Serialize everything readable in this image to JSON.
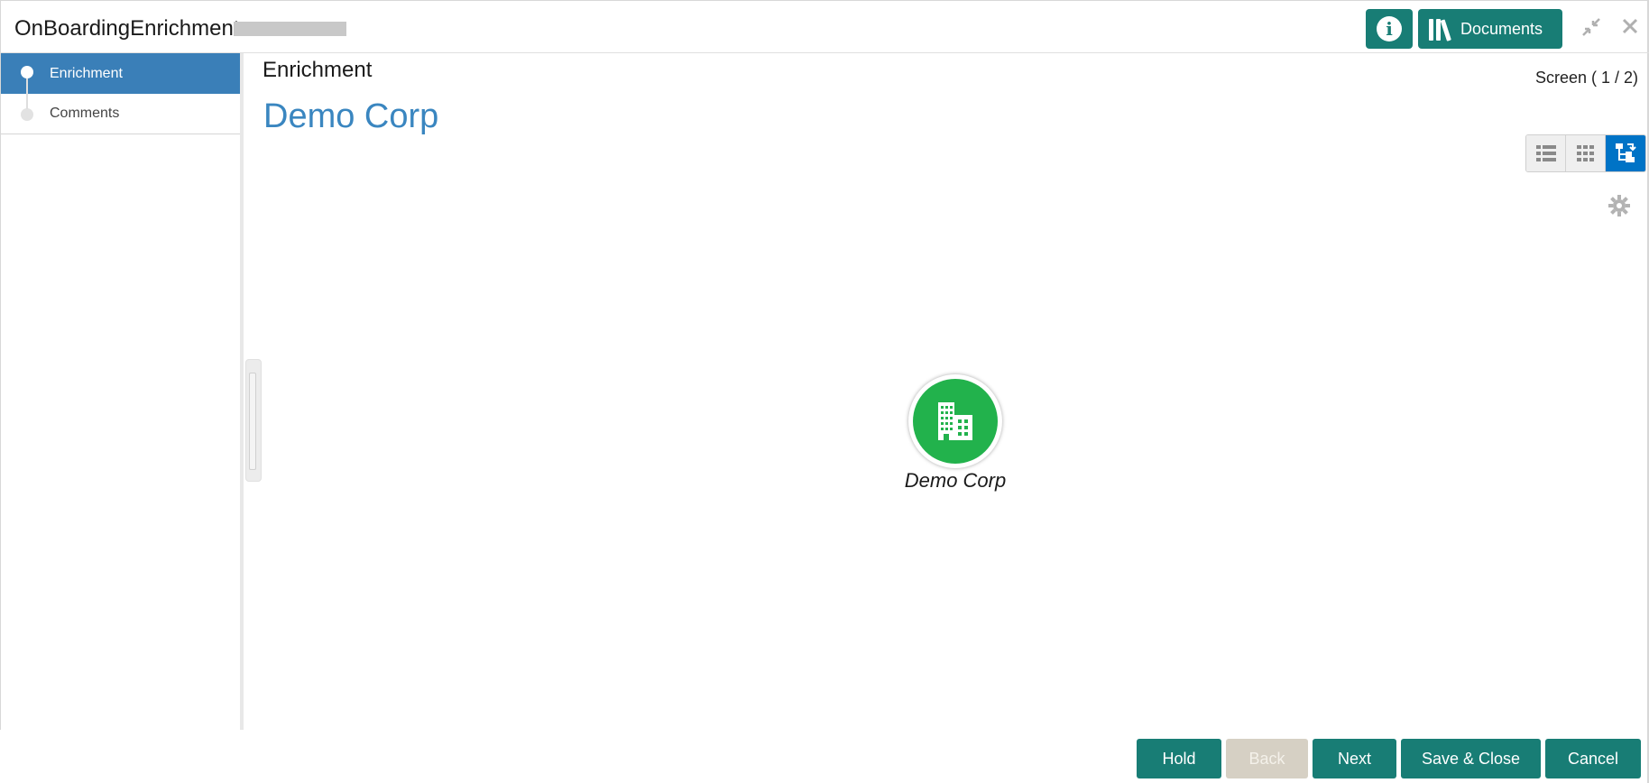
{
  "header": {
    "title": "OnBoardingEnrichment -",
    "documents_label": "Documents",
    "info_icon": "i"
  },
  "sidebar": {
    "steps": [
      {
        "label": "Enrichment",
        "active": true
      },
      {
        "label": "Comments",
        "active": false
      }
    ]
  },
  "main": {
    "section_title": "Enrichment",
    "screen_count": "Screen ( 1 / 2)",
    "entity_name": "Demo Corp",
    "view_modes": [
      "list-view-icon",
      "grid-view-icon",
      "tree-view-icon"
    ],
    "active_view": "tree-view-icon",
    "node": {
      "label": "Demo Corp",
      "icon": "building-icon",
      "color": "#22b24c"
    }
  },
  "footer": {
    "hold_label": "Hold",
    "back_label": "Back",
    "next_label": "Next",
    "save_close_label": "Save & Close",
    "cancel_label": "Cancel"
  },
  "colors": {
    "primary": "#187d75",
    "active_step": "#3a7fb8",
    "entity_title": "#3a86c0",
    "active_toggle": "#0073c6"
  }
}
